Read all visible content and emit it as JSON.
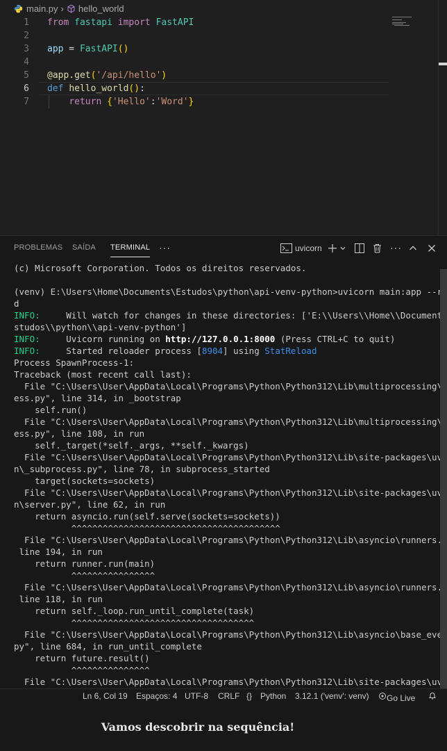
{
  "breadcrumb": {
    "file": "main.py",
    "symbol": "hello_world"
  },
  "code": {
    "line_numbers": [
      "1",
      "2",
      "3",
      "4",
      "5",
      "6",
      "7"
    ],
    "l1": {
      "from": "from",
      "module": "fastapi",
      "import": "import",
      "name": "FastAPI"
    },
    "l3": {
      "var": "app",
      "eq": " = ",
      "call": "FastAPI",
      "paren": "()"
    },
    "l5": {
      "deco": "@app.get",
      "popen": "(",
      "str": "'/api/hello'",
      "pclose": ")"
    },
    "l6": {
      "def": "def",
      "fn": "hello_world",
      "paren": "()",
      "colon": ":"
    },
    "l7": {
      "ret": "return",
      "bopen": "{",
      "k": "'Hello'",
      "colon": ":",
      "v": "'Word'",
      "bclose": "}"
    }
  },
  "panel": {
    "tabs": [
      "PROBLEMAS",
      "SAÍDA",
      "TERMINAL"
    ],
    "more": "···",
    "terminal_name": "uvicorn"
  },
  "terminal": {
    "l1": "(c) Microsoft Corporation. Todos os direitos reservados.",
    "l2": "(venv) E:\\Users\\Home\\Documents\\Estudos\\python\\api-venv-python>uvicorn main:app --reloa",
    "l3": "d",
    "info": "INFO:",
    "l4": "     Will watch for changes in these directories: ['E:\\\\Users\\\\Home\\\\Documents\\\\E",
    "l5": "studos\\\\python\\\\api-venv-python']",
    "l6a": "     Uvicorn running on ",
    "l6b": "http://127.0.0.1:8000",
    "l6c": " (Press CTRL+C to quit)",
    "l7a": "     Started reloader process [",
    "l7b": "8904",
    "l7c": "] using ",
    "l7d": "StatReload",
    "rest": [
      "Process SpawnProcess-1:",
      "Traceback (most recent call last):",
      "  File \"C:\\Users\\User\\AppData\\Local\\Programs\\Python\\Python312\\Lib\\multiprocessing\\proc",
      "ess.py\", line 314, in _bootstrap",
      "    self.run()",
      "  File \"C:\\Users\\User\\AppData\\Local\\Programs\\Python\\Python312\\Lib\\multiprocessing\\proc",
      "ess.py\", line 108, in run",
      "    self._target(*self._args, **self._kwargs)",
      "  File \"C:\\Users\\User\\AppData\\Local\\Programs\\Python\\Python312\\Lib\\site-packages\\uvicor",
      "n\\_subprocess.py\", line 78, in subprocess_started",
      "    target(sockets=sockets)",
      "  File \"C:\\Users\\User\\AppData\\Local\\Programs\\Python\\Python312\\Lib\\site-packages\\uvicor",
      "n\\server.py\", line 62, in run",
      "    return asyncio.run(self.serve(sockets=sockets))",
      "           ^^^^^^^^^^^^^^^^^^^^^^^^^^^^^^^^^^^^^^^^",
      "  File \"C:\\Users\\User\\AppData\\Local\\Programs\\Python\\Python312\\Lib\\asyncio\\runners.py\",",
      " line 194, in run",
      "    return runner.run(main)",
      "           ^^^^^^^^^^^^^^^^",
      "  File \"C:\\Users\\User\\AppData\\Local\\Programs\\Python\\Python312\\Lib\\asyncio\\runners.py\",",
      " line 118, in run",
      "    return self._loop.run_until_complete(task)",
      "           ^^^^^^^^^^^^^^^^^^^^^^^^^^^^^^^^^^^",
      "  File \"C:\\Users\\User\\AppData\\Local\\Programs\\Python\\Python312\\Lib\\asyncio\\base_events.",
      "py\", line 684, in run_until_complete",
      "    return future.result()",
      "           ^^^^^^^^^^^^^^^",
      "  File \"C:\\Users\\User\\AppData\\Local\\Programs\\Python\\Python312\\Lib\\site-packages\\uvicor"
    ]
  },
  "status": {
    "position": "Ln 6, Col 19",
    "spaces": "Espaços: 4",
    "encoding": "UTF-8",
    "eol": "CRLF",
    "braces": "{}",
    "language": "Python",
    "interpreter": "3.12.1 ('venv': venv)",
    "golive": "Go Live"
  },
  "caption": "Vamos descobrir na sequência!",
  "colors": {
    "accent_info": "#23d18b",
    "number": "#3b8eea",
    "keyword": "#569cd6",
    "string": "#ce9178"
  },
  "icons": [
    "python-file-icon",
    "chevron-right-icon",
    "symbol-method-icon",
    "terminal-icon",
    "plus-icon",
    "chevron-down-icon",
    "split-icon",
    "trash-icon",
    "ellipsis-icon",
    "chevron-up-icon",
    "close-icon",
    "braces-icon",
    "broadcast-icon",
    "bell-icon"
  ]
}
